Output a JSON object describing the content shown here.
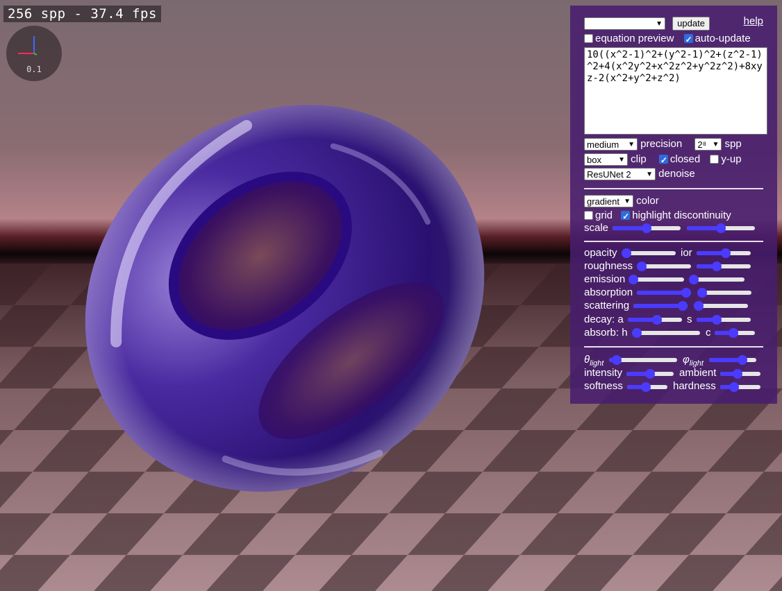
{
  "status": {
    "fps_text": "256 spp - 37.4 fps"
  },
  "gizmo": {
    "scale_text": "0.1"
  },
  "panel": {
    "preset_select": "",
    "update_button": "update",
    "help_link": "help",
    "equation_preview": {
      "label": "equation preview",
      "checked": false
    },
    "auto_update": {
      "label": "auto-update",
      "checked": true
    },
    "equation": "10((x^2-1)^2+(y^2-1)^2+(z^2-1)^2+4(x^2y^2+x^2z^2+y^2z^2)+8xyz-2(x^2+y^2+z^2)",
    "precision": {
      "value": "medium",
      "label": "precision"
    },
    "spp": {
      "value": "2⁸",
      "label": "spp"
    },
    "clip": {
      "value": "box",
      "label": "clip"
    },
    "closed": {
      "label": "closed",
      "checked": true
    },
    "yup": {
      "label": "y-up",
      "checked": false
    },
    "denoise": {
      "value": "ResUNet 2",
      "label": "denoise"
    },
    "color": {
      "value": "gradient",
      "label": "color"
    },
    "grid": {
      "label": "grid",
      "checked": false
    },
    "highlight": {
      "label": "highlight discontinuity",
      "checked": true
    },
    "scale": {
      "label": "scale",
      "a": 0.5,
      "b": 0.5
    },
    "material": {
      "opacity_label": "opacity",
      "opacity": 0.0,
      "ior_label": "ior",
      "ior": 0.55,
      "roughness_label": "roughness",
      "roughness": 0.0,
      "roughness2": 0.35,
      "emission_label": "emission",
      "emission": 0.0,
      "emission2": 0.0,
      "absorption_label": "absorption",
      "absorption": 1.0,
      "absorption2": 0.0,
      "scattering_label": "scattering",
      "scattering": 1.0,
      "scattering2": 0.0,
      "decay_a_label": "decay: a",
      "decay_a": 0.55,
      "decay_s_label": "s",
      "decay_s": 0.35,
      "absorb_h_label": "absorb: h",
      "absorb_h": 0.0,
      "absorb_c_label": "c",
      "absorb_c": 0.45
    },
    "light": {
      "theta_symbol": "θ",
      "theta_sub": "light",
      "theta": 0.05,
      "phi_symbol": "φ",
      "phi_sub": "light",
      "phi": 0.75,
      "intensity_label": "intensity",
      "intensity": 0.5,
      "ambient_label": "ambient",
      "ambient": 0.4,
      "softness_label": "softness",
      "softness": 0.45,
      "hardness_label": "hardness",
      "hardness": 0.3
    }
  },
  "colors": {
    "panel": "#481e6e",
    "slider": "#4a3bff",
    "object": "#3a1a8a"
  }
}
